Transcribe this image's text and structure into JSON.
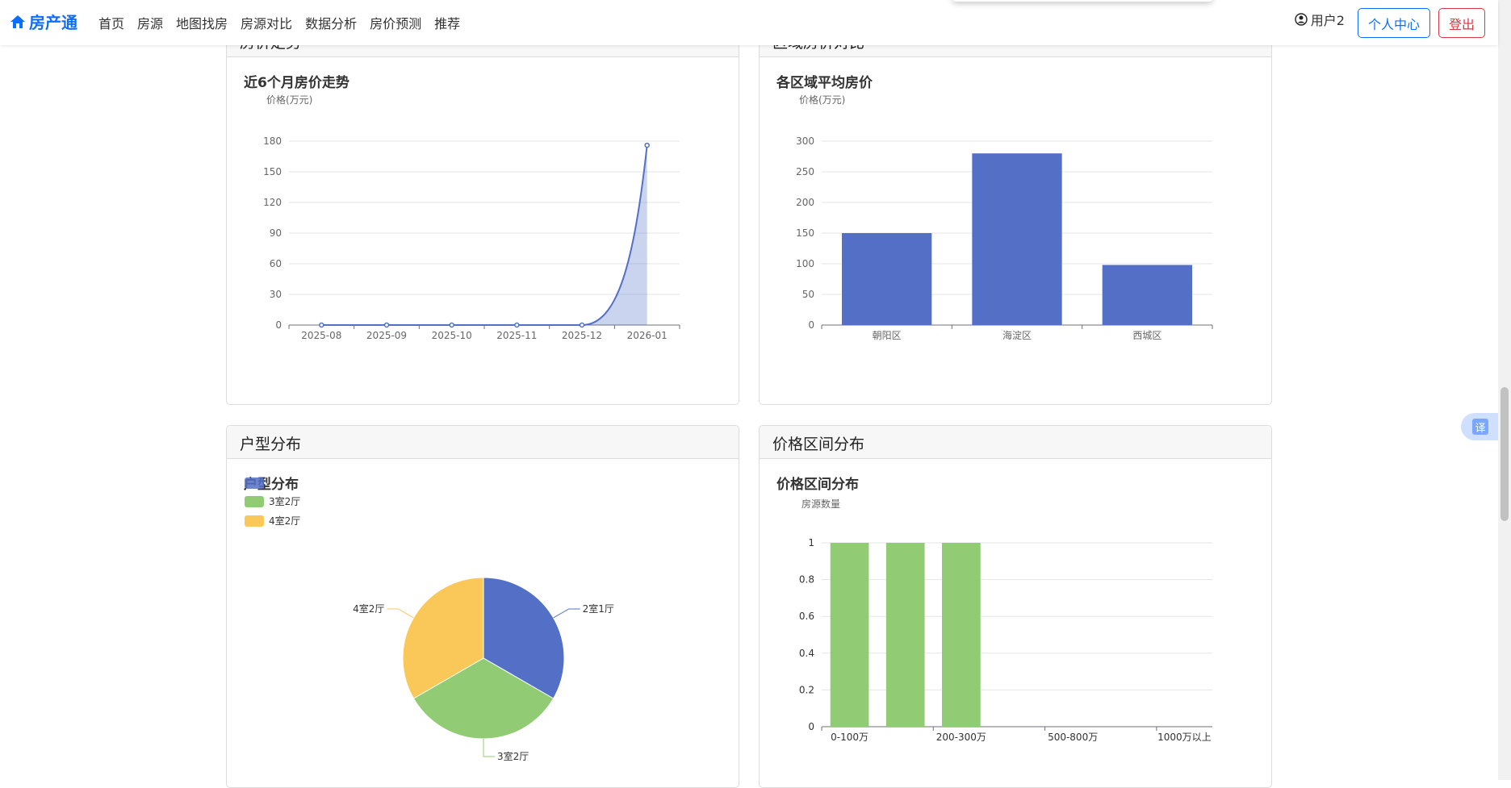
{
  "nav": {
    "brand": "房产通",
    "links": [
      "首页",
      "房源",
      "地图找房",
      "房源对比",
      "数据分析",
      "房价预测",
      "推荐"
    ],
    "user": "用户2",
    "profile_btn": "个人中心",
    "logout_btn": "登出"
  },
  "cards": {
    "trend": {
      "header": "房价走势",
      "title": "近6个月房价走势",
      "ylabel": "价格(万元)"
    },
    "district": {
      "header": "区域房价对比",
      "title": "各区域平均房价",
      "ylabel": "价格(万元)"
    },
    "layout": {
      "header": "户型分布",
      "title": "户型分布"
    },
    "price_range": {
      "header": "价格区间分布",
      "title": "价格区间分布",
      "ylabel": "房源数量"
    }
  },
  "translate_label": "译",
  "chart_data": [
    {
      "type": "area",
      "title": "近6个月房价走势",
      "ylabel": "价格(万元)",
      "x": [
        "2025-08",
        "2025-09",
        "2025-10",
        "2025-11",
        "2025-12",
        "2026-01"
      ],
      "values": [
        0,
        0,
        0,
        0,
        0,
        176
      ],
      "yticks": [
        0,
        30,
        60,
        90,
        120,
        150,
        180
      ],
      "ylim": [
        0,
        180
      ],
      "color": "#5470c6",
      "grid": true
    },
    {
      "type": "bar",
      "title": "各区域平均房价",
      "ylabel": "价格(万元)",
      "categories": [
        "朝阳区",
        "海淀区",
        "西城区"
      ],
      "values": [
        150,
        280,
        98
      ],
      "yticks": [
        0,
        50,
        100,
        150,
        200,
        250,
        300
      ],
      "ylim": [
        0,
        300
      ],
      "color": "#5470c6",
      "grid": true
    },
    {
      "type": "pie",
      "title": "户型分布",
      "labels": [
        "2室1厅",
        "3室2厅",
        "4室2厅"
      ],
      "values": [
        1,
        1,
        1
      ],
      "colors": [
        "#5470c6",
        "#91cc75",
        "#fac858"
      ],
      "legend": [
        "3室2厅",
        "4室2厅"
      ],
      "legend_placement": "top-left"
    },
    {
      "type": "bar",
      "title": "价格区间分布",
      "ylabel": "房源数量",
      "tick_labels": [
        "0-100万",
        "200-300万",
        "500-800万",
        "1000万以上"
      ],
      "values": [
        1,
        1,
        1,
        0,
        0,
        0,
        0
      ],
      "yticks": [
        "0",
        "0.2",
        "0.4",
        "0.6",
        "0.8",
        "1"
      ],
      "ylim": [
        0,
        1
      ],
      "color": "#91cc75",
      "grid": true
    }
  ]
}
